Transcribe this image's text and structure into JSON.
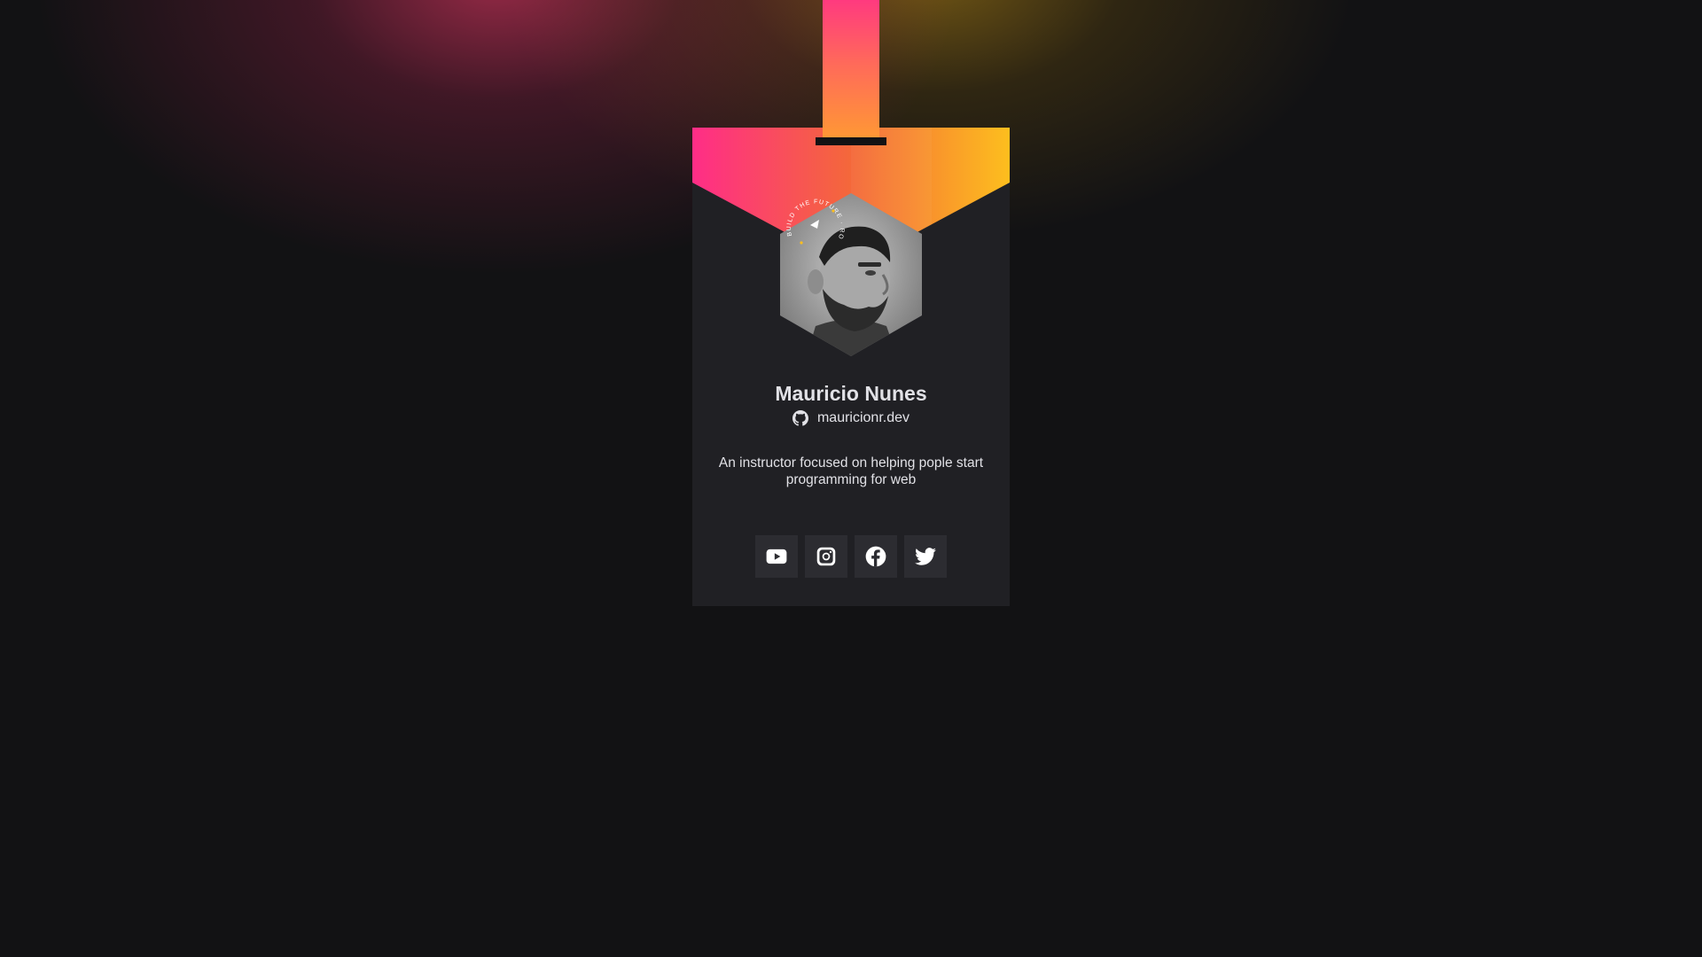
{
  "profile": {
    "name": "Mauricio Nunes",
    "handle": "mauricionr.dev",
    "bio": "An instructor focused on helping pople start programming for web",
    "avatar_badge_text": "BUILD THE FUTURE · ROCKETSEAT"
  },
  "socials": [
    {
      "name": "YouTube",
      "icon": "youtube-icon"
    },
    {
      "name": "Instagram",
      "icon": "instagram-icon"
    },
    {
      "name": "Facebook",
      "icon": "facebook-icon"
    },
    {
      "name": "Twitter",
      "icon": "twitter-icon"
    }
  ],
  "colors": {
    "background": "#121214",
    "card": "#202024",
    "button": "#2c2c31",
    "text": "#e1e1e6",
    "gradient_start": "#ff2d87",
    "gradient_end": "#fdbe1e"
  }
}
